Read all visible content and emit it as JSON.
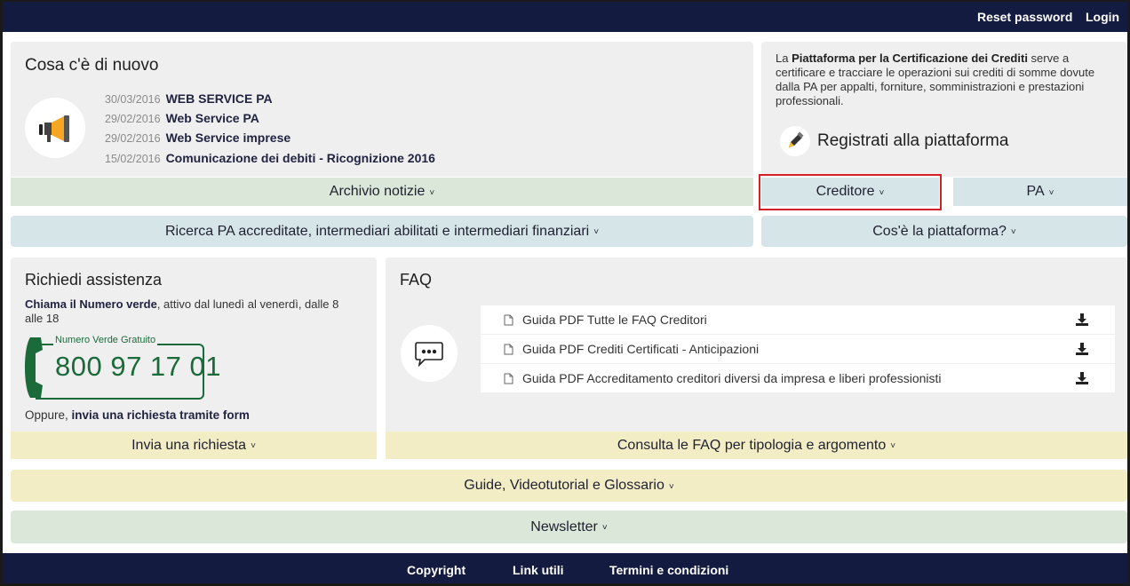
{
  "header": {
    "reset_password": "Reset password",
    "login": "Login"
  },
  "news": {
    "title": "Cosa c'è di nuovo",
    "items": [
      {
        "date": "30/03/2016",
        "title": "WEB SERVICE PA"
      },
      {
        "date": "29/02/2016",
        "title": "Web Service PA"
      },
      {
        "date": "29/02/2016",
        "title": "Web Service imprese"
      },
      {
        "date": "15/02/2016",
        "title": "Comunicazione dei debiti - Ricognizione 2016"
      }
    ],
    "archive_label": "Archivio notizie"
  },
  "platform_info": {
    "text_prefix": "La ",
    "text_bold": "Piattaforma per la Certificazione dei Crediti",
    "text_suffix": " serve a certificare e tracciare le operazioni sui crediti di somme dovute dalla PA per appalti, forniture, somministrazioni e prestazioni professionali.",
    "register_label": "Registrati alla piattaforma",
    "creditore_label": "Creditore",
    "pa_label": "PA"
  },
  "search_bar": {
    "label": "Ricerca PA accreditate, intermediari abilitati e intermediari finanziari"
  },
  "about_bar": {
    "label": "Cos'è la piattaforma?"
  },
  "assistance": {
    "title": "Richiedi assistenza",
    "call_bold": "Chiama il Numero verde",
    "call_rest": ", attivo dal lunedì al venerdì, dalle 8 alle 18",
    "toll_free_label": "Numero Verde Gratuito",
    "phone_number": "800 97 17 01",
    "or_text": "Oppure, ",
    "form_bold": "invia una richiesta tramite form",
    "send_label": "Invia una richiesta"
  },
  "faq": {
    "title": "FAQ",
    "items": [
      {
        "label": "Guida PDF Tutte le FAQ Creditori"
      },
      {
        "label": "Guida PDF Crediti Certificati - Anticipazioni"
      },
      {
        "label": "Guida PDF Accreditamento creditori diversi da impresa e liberi professionisti"
      }
    ],
    "consult_label": "Consulta le FAQ per tipologia e argomento"
  },
  "guides_bar": {
    "label": "Guide, Videotutorial e Glossario"
  },
  "newsletter_bar": {
    "label": "Newsletter"
  },
  "footer": {
    "copyright": "Copyright",
    "links": "Link utili",
    "terms": "Termini e condizioni"
  },
  "colors": {
    "navy": "#141b40",
    "highlight_red": "#d32025",
    "toll_free_green": "#1b6b3a",
    "megaphone_orange": "#f5a623"
  },
  "icons": {
    "news": "megaphone-icon",
    "register": "pencil-icon",
    "faq": "chat-bubble-icon",
    "faq_item": "document-icon",
    "download": "download-icon",
    "phone": "phone-handset-icon",
    "dropdown": "chevron-down-icon"
  }
}
